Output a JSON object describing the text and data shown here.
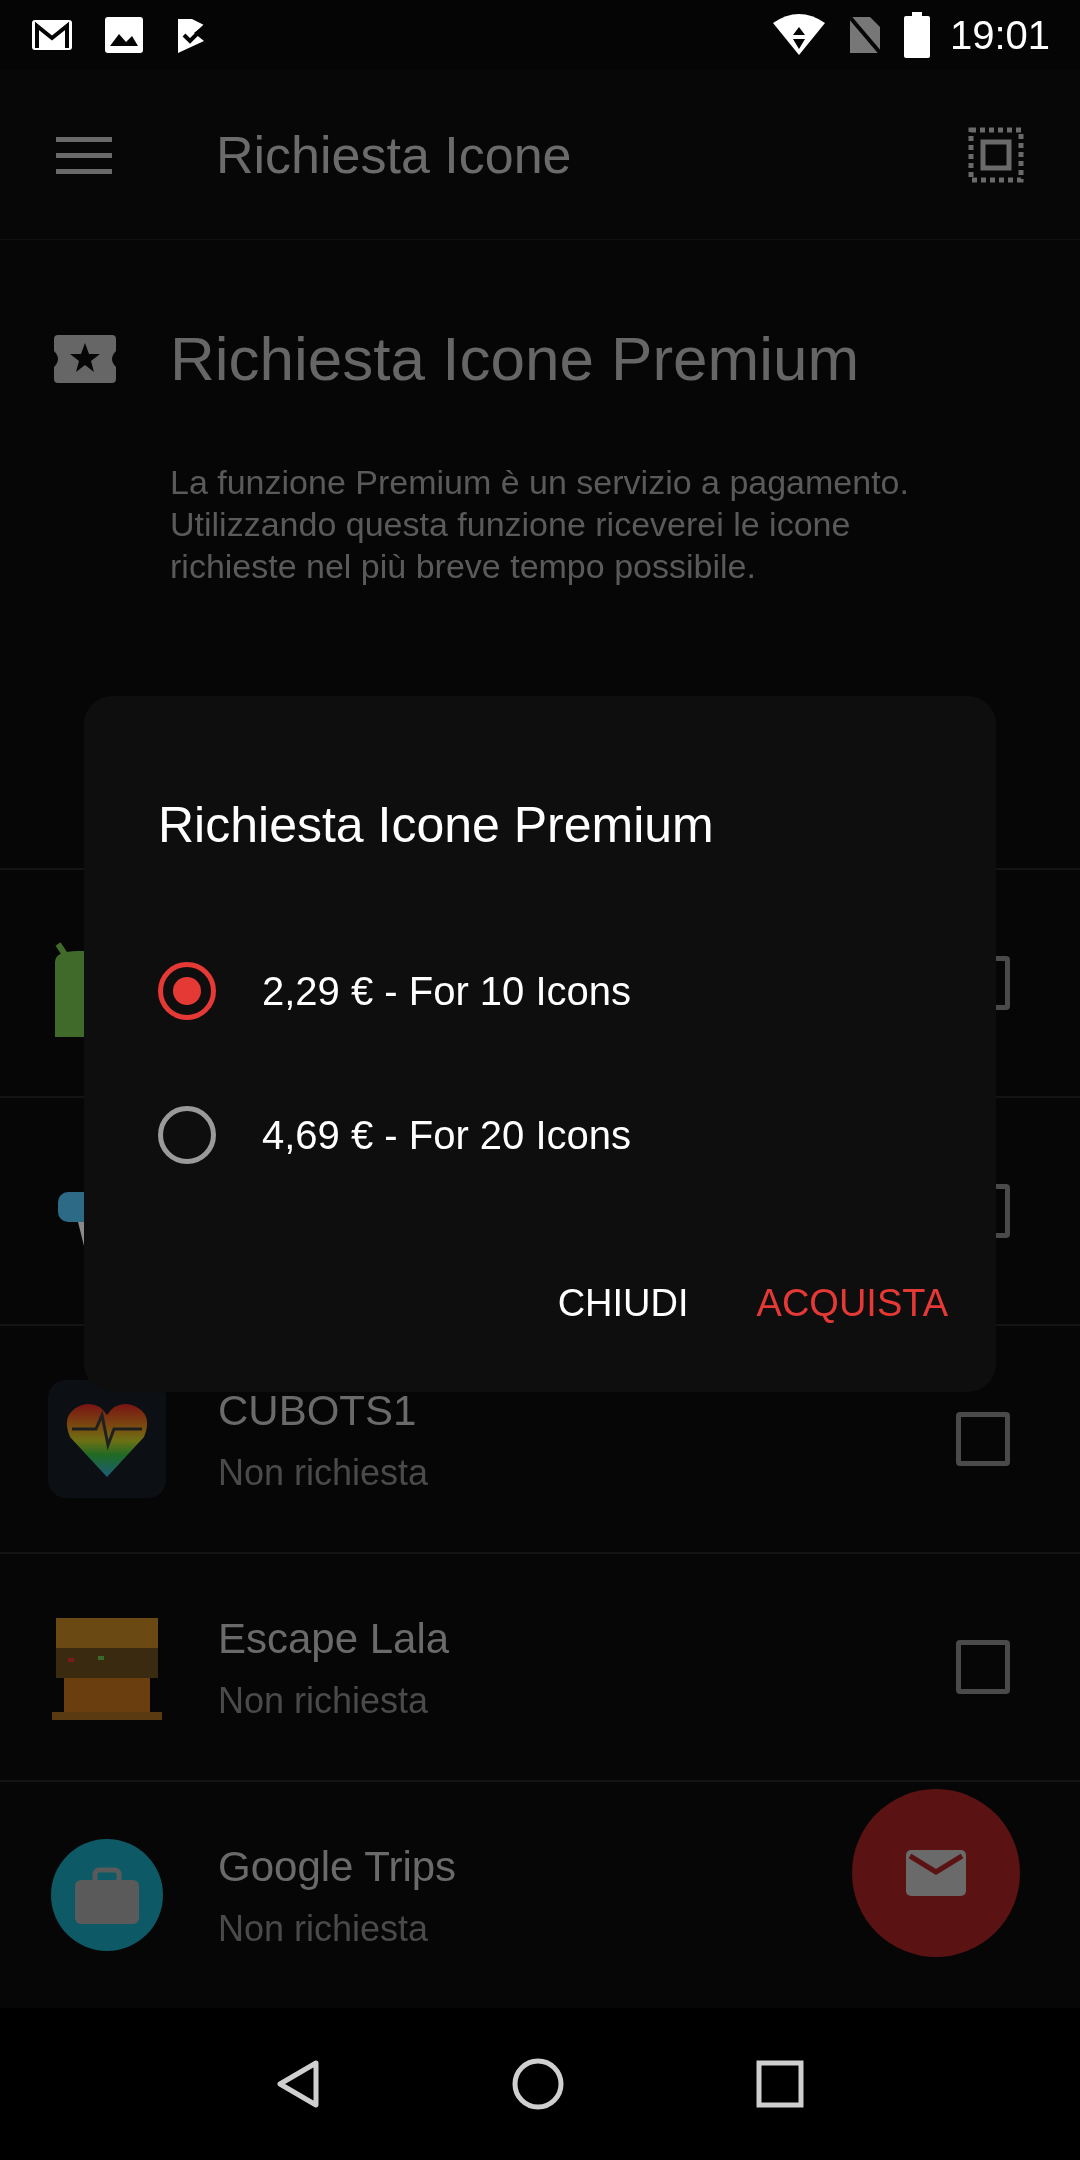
{
  "status_bar": {
    "time": "19:01"
  },
  "app_bar": {
    "title": "Richiesta Icone"
  },
  "premium": {
    "title": "Richiesta Icone Premium",
    "description": "La funzione Premium è un servizio a pagamento. Utilizzando questa funzione riceverei le icone richieste nel più breve tempo possibile."
  },
  "apps": [
    {
      "checked": false
    },
    {
      "checked": false
    },
    {
      "name": "CUBOTS1",
      "status": "Non richiesta",
      "checked": false
    },
    {
      "name": "Escape Lala",
      "status": "Non richiesta",
      "checked": false
    },
    {
      "name": "Google Trips",
      "status": "Non richiesta"
    }
  ],
  "dialog": {
    "title": "Richiesta Icone Premium",
    "options": [
      {
        "label": "2,29 € - For 10 Icons",
        "selected": true
      },
      {
        "label": "4,69 € - For 20 Icons",
        "selected": false
      }
    ],
    "buttons": [
      {
        "label": "CHIUDI",
        "kind": "neutral"
      },
      {
        "label": "ACQUISTA",
        "kind": "primary"
      }
    ]
  }
}
